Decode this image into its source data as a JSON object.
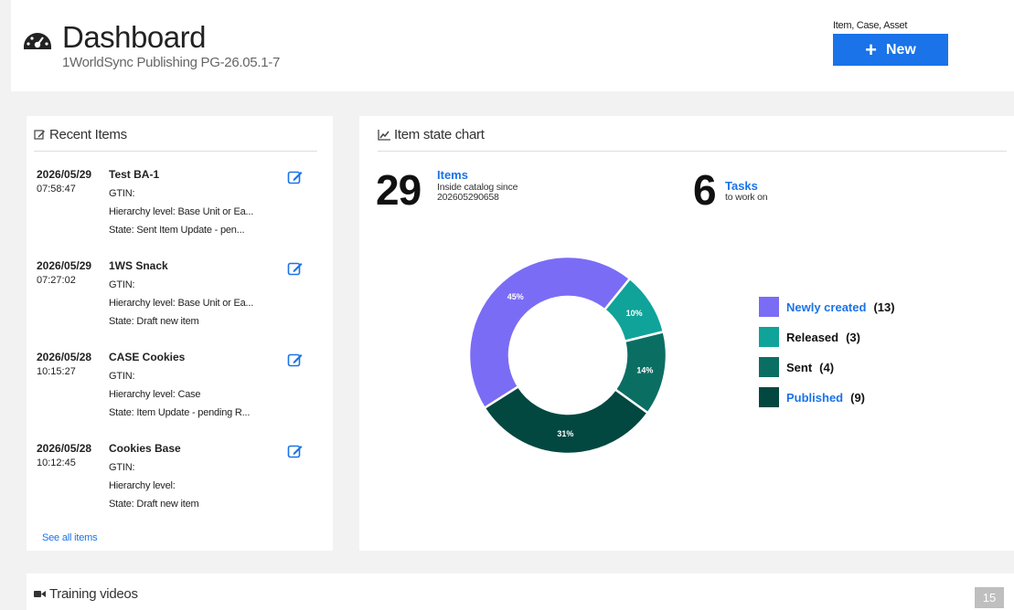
{
  "header": {
    "title": "Dashboard",
    "subtitle": "1WorldSync Publishing PG-26.05.1-7",
    "new_caption": "Item, Case, Asset",
    "new_label": "New"
  },
  "recent": {
    "title": "Recent Items",
    "see_all": "See all items",
    "items": [
      {
        "date": "2026/05/29",
        "time": "07:58:47",
        "name": "Test BA-1",
        "gtin": "GTIN:",
        "hierarchy": "Hierarchy level: Base Unit or Ea...",
        "state": "State: Sent Item Update - pen..."
      },
      {
        "date": "2026/05/29",
        "time": "07:27:02",
        "name": "1WS Snack",
        "gtin": "GTIN:",
        "hierarchy": "Hierarchy level: Base Unit or Ea...",
        "state": "State: Draft new item"
      },
      {
        "date": "2026/05/28",
        "time": "10:15:27",
        "name": "CASE Cookies",
        "gtin": "GTIN:",
        "hierarchy": "Hierarchy level: Case",
        "state": "State: Item Update - pending R..."
      },
      {
        "date": "2026/05/28",
        "time": "10:12:45",
        "name": "Cookies Base",
        "gtin": "GTIN:",
        "hierarchy": "Hierarchy level:",
        "state": "State: Draft new item"
      }
    ]
  },
  "chart_panel": {
    "title": "Item state chart",
    "items_count": "29",
    "items_label": "Items",
    "items_sub1": "Inside catalog since",
    "items_sub2": "202605290658",
    "tasks_count": "6",
    "tasks_label": "Tasks",
    "tasks_sub": "to work on"
  },
  "chart_data": {
    "type": "pie",
    "donut": true,
    "categories": [
      "Newly created",
      "Released",
      "Sent",
      "Published"
    ],
    "values": [
      13,
      3,
      4,
      9
    ],
    "percent_labels": [
      "45%",
      "10%",
      "14%",
      "31%"
    ],
    "legend_counts": [
      "(13)",
      "(3)",
      "(4)",
      "(9)"
    ],
    "colors": [
      "#7b6cf6",
      "#0fa39a",
      "#0b6e63",
      "#024840"
    ],
    "legend_link": [
      true,
      false,
      false,
      true
    ],
    "legend_position": "right"
  },
  "training": {
    "title": "Training videos",
    "page_badge": "15"
  },
  "icons": {
    "dashboard": "dashboard-icon",
    "edit": "edit-icon",
    "line_chart": "line-chart-icon",
    "video": "video-camera-icon"
  }
}
